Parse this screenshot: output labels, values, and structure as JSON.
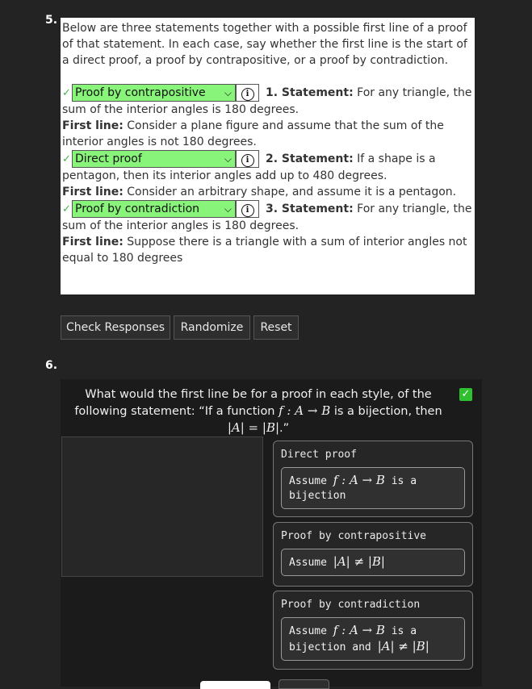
{
  "q5": {
    "number": "5.",
    "intro": "Below are three statements together with a possible first line of a proof of that statement. In each case, say whether the first line is the start of a direct proof, a proof by contrapositive, or a proof by contradiction.",
    "items": [
      {
        "check": "✓",
        "selected": "Proof by contrapositive",
        "statement_label": "1. Statement:",
        "statement": " For any triangle, the sum of the interior angles is 180 degrees.",
        "first_line_label": "First line:",
        "first_line": " Consider a plane figure and assume that the sum of the interior angles is not 180 degrees."
      },
      {
        "check": "✓",
        "selected": "Direct proof",
        "statement_label": "2. Statement:",
        "statement": " If a shape is a pentagon, then its interior angles add up to 480 degrees.",
        "first_line_label": "First line:",
        "first_line": " Consider an arbitrary shape, and assume it is a pentagon."
      },
      {
        "check": "✓",
        "selected": "Proof by contradiction",
        "statement_label": "3. Statement:",
        "statement": " For any triangle, the sum of the interior angles is 180 degrees.",
        "first_line_label": "First line:",
        "first_line": " Suppose there is a triangle with a sum of interior angles not equal to 180 degrees"
      }
    ],
    "buttons": {
      "check": "Check Responses",
      "randomize": "Randomize",
      "reset": "Reset"
    }
  },
  "q6": {
    "number": "6.",
    "prompt_a": "What would the first line be for a proof in each style, of the following statement: “If a function ",
    "prompt_math1": "f : A → B",
    "prompt_b": " is a bijection, then ",
    "prompt_math2": "|A| = |B|",
    "prompt_c": ".”",
    "check": "✓",
    "cards": [
      {
        "title": "Direct proof",
        "answer_pre": "Assume ",
        "answer_math": "f : A → B",
        "answer_post": " is a bijection",
        "answer_math2": "",
        "answer_post2": ""
      },
      {
        "title": "Proof by contrapositive",
        "answer_pre": "Assume ",
        "answer_math": "|A| ≠ |B|",
        "answer_post": "",
        "answer_math2": "",
        "answer_post2": ""
      },
      {
        "title": "Proof by contradiction",
        "answer_pre": "Assume ",
        "answer_math": "f : A → B",
        "answer_post": " is a bijection and ",
        "answer_math2": "|A| ≠ |B|",
        "answer_post2": ""
      }
    ]
  }
}
